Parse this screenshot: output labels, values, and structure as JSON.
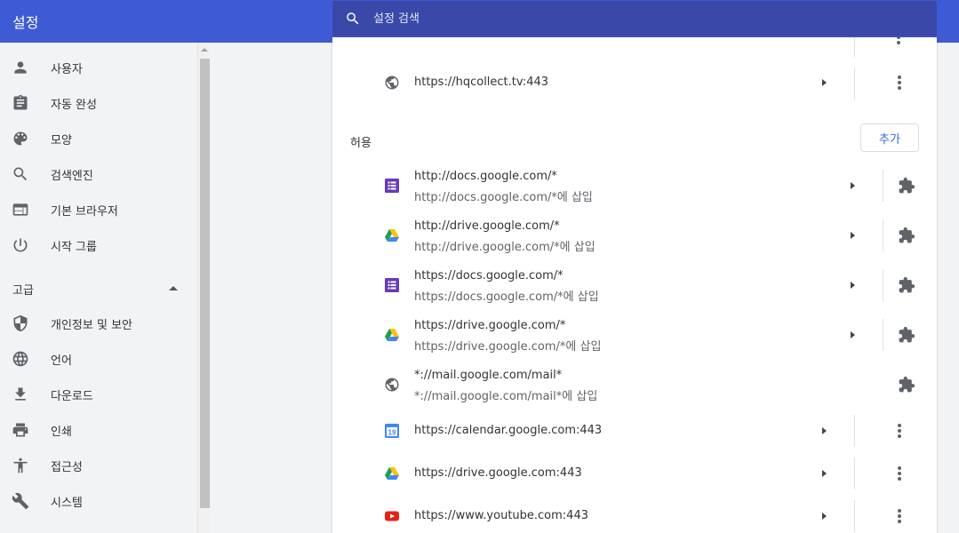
{
  "header": {
    "title": "설정",
    "search_placeholder": "설정 검색"
  },
  "sidebar": {
    "items": [
      {
        "label": "사용자",
        "icon": "person-icon"
      },
      {
        "label": "자동 완성",
        "icon": "clipboard-icon"
      },
      {
        "label": "모양",
        "icon": "palette-icon"
      },
      {
        "label": "검색엔진",
        "icon": "search-icon"
      },
      {
        "label": "기본 브라우저",
        "icon": "browser-icon"
      },
      {
        "label": "시작 그룹",
        "icon": "power-icon"
      }
    ],
    "advanced_label": "고급",
    "advanced_items": [
      {
        "label": "개인정보 및 보안",
        "icon": "shield-icon"
      },
      {
        "label": "언어",
        "icon": "globe-icon"
      },
      {
        "label": "다운로드",
        "icon": "download-icon"
      },
      {
        "label": "인쇄",
        "icon": "printer-icon"
      },
      {
        "label": "접근성",
        "icon": "accessibility-icon"
      },
      {
        "label": "시스템",
        "icon": "wrench-icon"
      }
    ]
  },
  "main": {
    "block_last_site": "https://hqcollect.tv:443",
    "allow_label": "허용",
    "add_button": "추가",
    "allow_items": [
      {
        "url": "http://docs.google.com/*",
        "sub": "http://docs.google.com/*에 삽입",
        "icon": "google-docs-icon"
      },
      {
        "url": "http://drive.google.com/*",
        "sub": "http://drive.google.com/*에 삽입",
        "icon": "google-drive-icon"
      },
      {
        "url": "https://docs.google.com/*",
        "sub": "https://docs.google.com/*에 삽입",
        "icon": "google-docs-icon"
      },
      {
        "url": "https://drive.google.com/*",
        "sub": "https://drive.google.com/*에 삽입",
        "icon": "google-drive-icon"
      },
      {
        "url": "*://mail.google.com/mail*",
        "sub": "*://mail.google.com/mail*에 삽입",
        "icon": "globe-icon"
      }
    ],
    "allow_sites": [
      {
        "url": "https://calendar.google.com:443",
        "icon": "google-calendar-icon",
        "calendar_day": "19"
      },
      {
        "url": "https://drive.google.com:443",
        "icon": "google-drive-icon"
      },
      {
        "url": "https://www.youtube.com:443",
        "icon": "youtube-icon"
      }
    ]
  },
  "colors": {
    "header": "#3e5bd5",
    "search": "#3a49a9",
    "accent": "#3367d6"
  }
}
